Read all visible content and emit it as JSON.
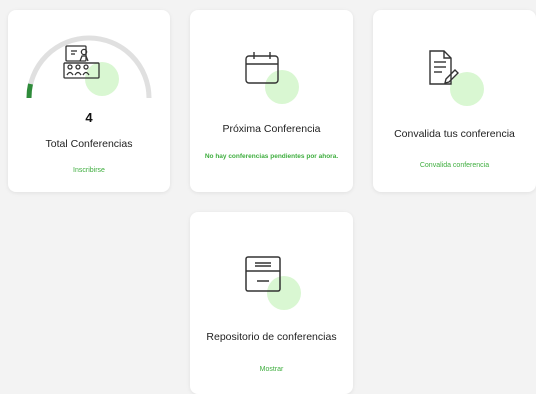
{
  "cards": {
    "total": {
      "count": "4",
      "title": "Total Conferencias",
      "link": "Inscribirse",
      "icon": "presentation-icon"
    },
    "proxima": {
      "title": "Próxima Conferencia",
      "message": "No hay conferencias pendientes por ahora.",
      "icon": "calendar-icon"
    },
    "convalida": {
      "title": "Convalida tus conferencia",
      "link": "Convalida conferencia",
      "icon": "document-edit-icon"
    },
    "repositorio": {
      "title": "Repositorio de conferencias",
      "link": "Mostrar",
      "icon": "archive-icon"
    }
  },
  "colors": {
    "accent": "#3fae3f",
    "gauge_fill": "#2e8b3a",
    "gauge_track": "#e0e0e0",
    "icon_blob": "#d9f7d2"
  }
}
